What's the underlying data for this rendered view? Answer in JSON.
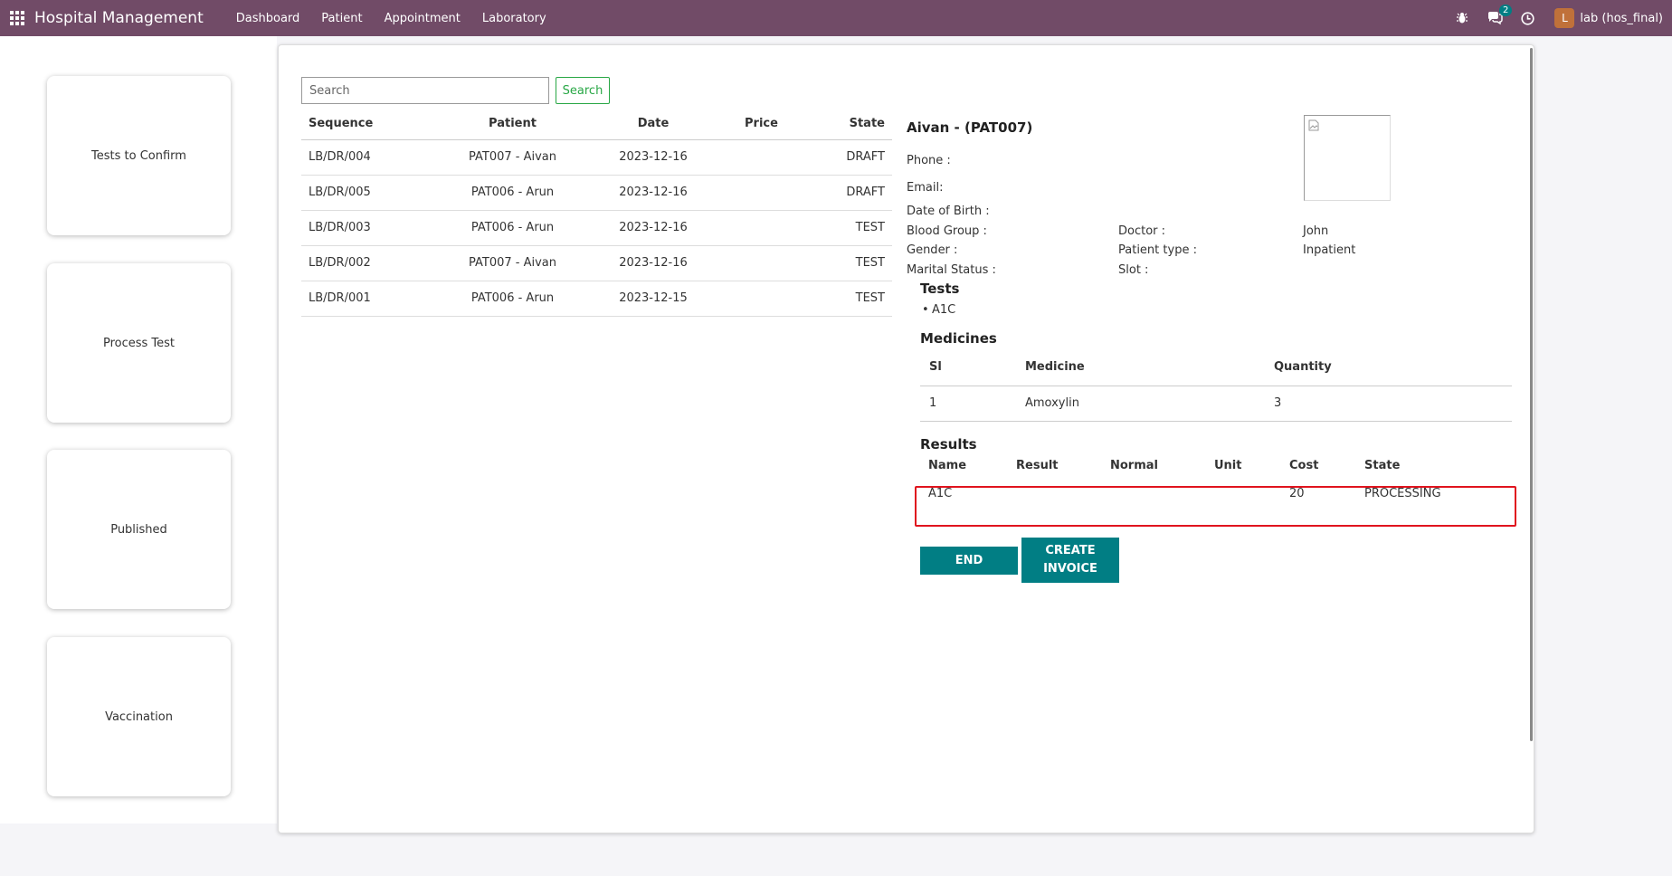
{
  "navbar": {
    "brand": "Hospital Management",
    "menu": [
      "Dashboard",
      "Patient",
      "Appointment",
      "Laboratory"
    ],
    "chat_count": "2",
    "user_initial": "L",
    "user_name": "lab (hos_final)"
  },
  "sidebar": {
    "cards": [
      "Tests to Confirm",
      "Process Test",
      "Published",
      "Vaccination"
    ]
  },
  "search": {
    "placeholder": "Search",
    "button": "Search"
  },
  "list": {
    "headers": [
      "Sequence",
      "Patient",
      "Date",
      "Price",
      "State"
    ],
    "rows": [
      {
        "sequence": "LB/DR/004",
        "patient": "PAT007 - Aivan",
        "date": "2023-12-16",
        "price": "",
        "state": "DRAFT"
      },
      {
        "sequence": "LB/DR/005",
        "patient": "PAT006 - Arun",
        "date": "2023-12-16",
        "price": "",
        "state": "DRAFT"
      },
      {
        "sequence": "LB/DR/003",
        "patient": "PAT006 - Arun",
        "date": "2023-12-16",
        "price": "",
        "state": "TEST"
      },
      {
        "sequence": "LB/DR/002",
        "patient": "PAT007 - Aivan",
        "date": "2023-12-16",
        "price": "",
        "state": "TEST"
      },
      {
        "sequence": "LB/DR/001",
        "patient": "PAT006 - Arun",
        "date": "2023-12-15",
        "price": "",
        "state": "TEST"
      }
    ]
  },
  "detail": {
    "title": "Aivan - (PAT007)",
    "phone_label": "Phone :",
    "email_label": "Email:",
    "dob_label": "Date of Birth :",
    "blood_group_label": "Blood Group :",
    "gender_label": "Gender :",
    "marital_status_label": "Marital Status :",
    "doctor_label": "Doctor :",
    "doctor_value": "John",
    "patient_type_label": "Patient type :",
    "patient_type_value": "Inpatient",
    "slot_label": "Slot :",
    "tests_title": "Tests",
    "tests": [
      "A1C"
    ],
    "medicines_title": "Medicines",
    "medicine_headers": [
      "Sl",
      "Medicine",
      "Quantity"
    ],
    "medicines": [
      {
        "sl": "1",
        "medicine": "Amoxylin",
        "quantity": "3"
      }
    ],
    "results_title": "Results",
    "result_headers": [
      "Name",
      "Result",
      "Normal",
      "Unit",
      "Cost",
      "State"
    ],
    "results": [
      {
        "name": "A1C",
        "result": "",
        "normal": "",
        "unit": "",
        "cost": "20",
        "state": "PROCESSING"
      }
    ],
    "end_button": "END",
    "create_invoice_line1": "CREATE",
    "create_invoice_line2": "INVOICE"
  },
  "colors": {
    "navbar": "#714b67",
    "teal": "#017e84",
    "search_green": "#28a745",
    "highlight_red": "#e0141e"
  }
}
